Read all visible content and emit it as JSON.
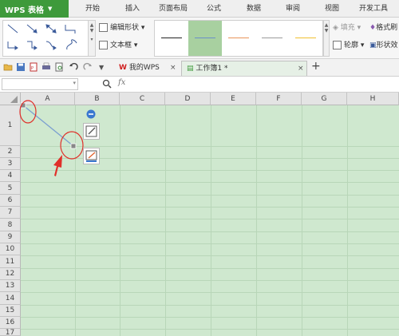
{
  "app": {
    "name": "WPS 表格"
  },
  "menu": {
    "items": [
      "开始",
      "插入",
      "页面布局",
      "公式",
      "数据",
      "审阅",
      "视图",
      "开发工具"
    ]
  },
  "ribbon": {
    "edit_shape": "编辑形状",
    "text_box": "文本框",
    "fill": "填充",
    "format_painter": "格式刷",
    "outline": "轮廓",
    "shape_effects": "形状效"
  },
  "tabs": [
    {
      "label": "我的WPS",
      "close": "×"
    },
    {
      "label": "工作簿1 *",
      "close": "×"
    }
  ],
  "formula": {
    "fx": "fx"
  },
  "sheet": {
    "columns": [
      "A",
      "B",
      "C",
      "D",
      "E",
      "F",
      "G",
      "H"
    ],
    "rows": [
      "1",
      "2",
      "3",
      "4",
      "5",
      "6",
      "7",
      "8",
      "9",
      "10",
      "11",
      "12",
      "13",
      "14",
      "15",
      "16",
      "17"
    ]
  },
  "colors": {
    "brand": "#3e9a3b",
    "grid_bg": "#cfe8cf",
    "annotation": "#e0302a",
    "line_shape": "#7b9fd0"
  }
}
